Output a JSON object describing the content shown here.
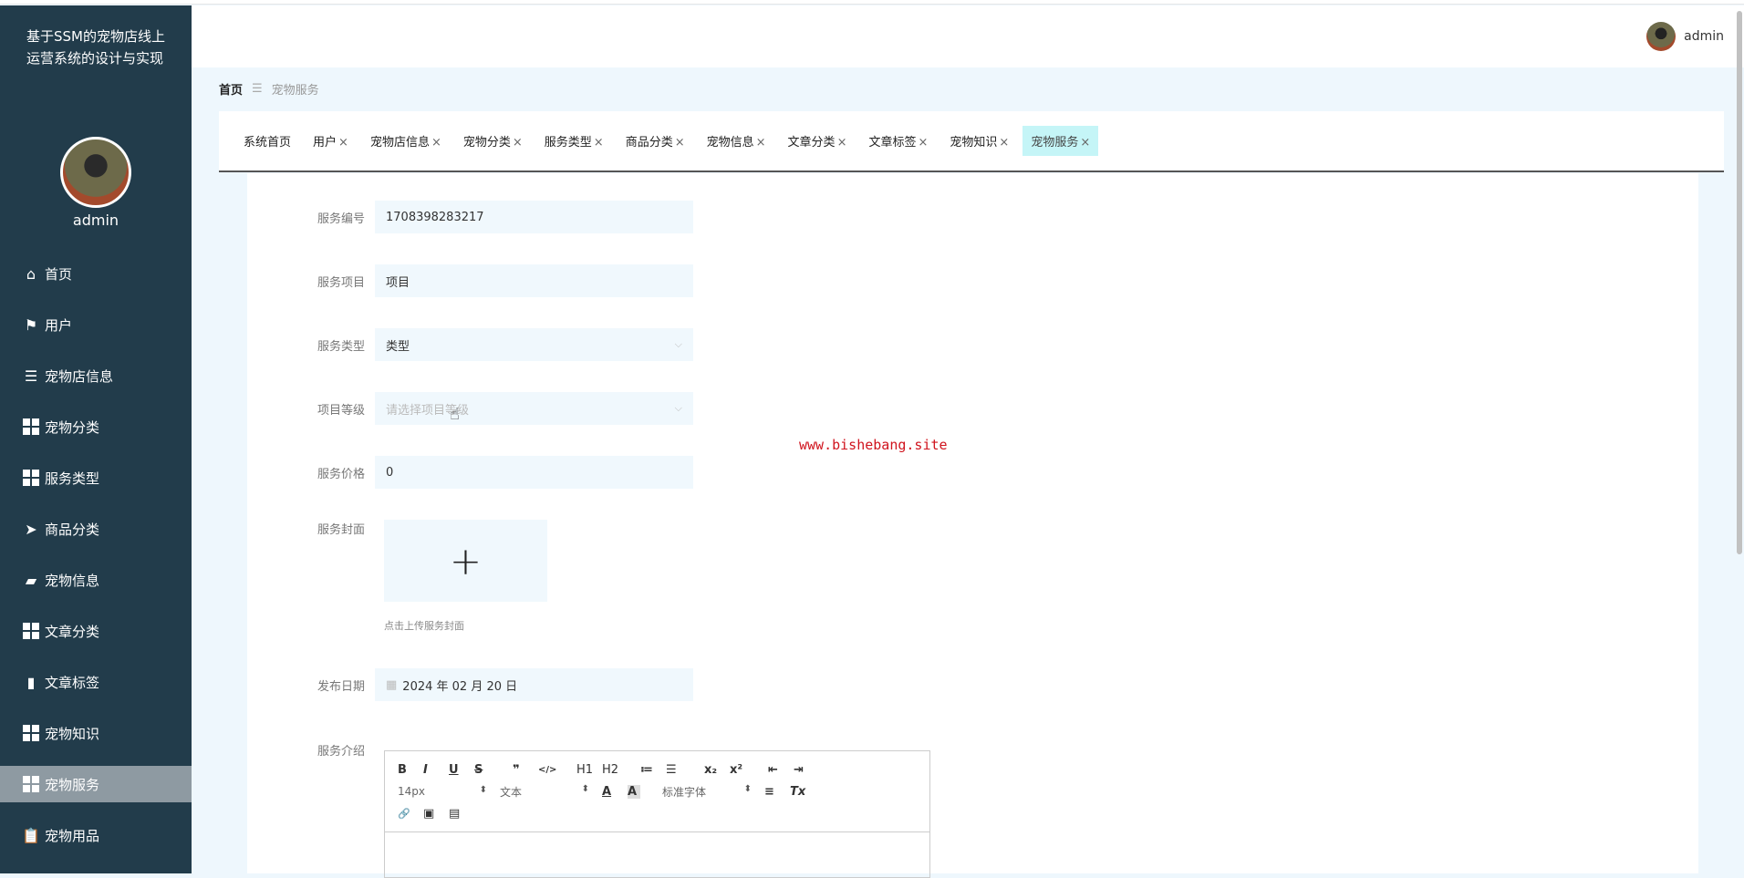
{
  "sidebar": {
    "title": "基于SSM的宠物店线上运营系统的设计与实现",
    "username": "admin",
    "items": [
      {
        "label": "首页",
        "icon": "home-icon"
      },
      {
        "label": "用户",
        "icon": "flag-icon"
      },
      {
        "label": "宠物店信息",
        "icon": "list-icon"
      },
      {
        "label": "宠物分类",
        "icon": "grid-icon"
      },
      {
        "label": "服务类型",
        "icon": "grid-icon"
      },
      {
        "label": "商品分类",
        "icon": "send-icon"
      },
      {
        "label": "宠物信息",
        "icon": "briefcase-icon"
      },
      {
        "label": "文章分类",
        "icon": "grid-icon"
      },
      {
        "label": "文章标签",
        "icon": "bar-chart-icon"
      },
      {
        "label": "宠物知识",
        "icon": "grid-icon"
      },
      {
        "label": "宠物服务",
        "icon": "grid-icon"
      },
      {
        "label": "宠物用品",
        "icon": "clipboard-icon"
      }
    ]
  },
  "header": {
    "username": "admin"
  },
  "breadcrumb": {
    "home": "首页",
    "separator": "☰",
    "current": "宠物服务"
  },
  "tabs": [
    "系统首页",
    "用户",
    "宠物店信息",
    "宠物分类",
    "服务类型",
    "商品分类",
    "宠物信息",
    "文章分类",
    "文章标签",
    "宠物知识",
    "宠物服务"
  ],
  "close_glyph": "×",
  "form": {
    "service_no": {
      "label": "服务编号",
      "value": "1708398283217"
    },
    "service_item": {
      "label": "服务项目",
      "value": "项目"
    },
    "service_type": {
      "label": "服务类型",
      "value": "类型"
    },
    "item_level": {
      "label": "项目等级",
      "placeholder": "请选择项目等级"
    },
    "price": {
      "label": "服务价格",
      "value": "0"
    },
    "cover": {
      "label": "服务封面",
      "plus": "+",
      "hint": "点击上传服务封面"
    },
    "date": {
      "label": "发布日期",
      "value": "2024 年 02 月 20 日"
    },
    "intro": {
      "label": "服务介绍"
    }
  },
  "editor": {
    "size": "14px",
    "header": "文本",
    "font": "标准字体",
    "buttons": {
      "bold": "B",
      "italic": "I",
      "underline": "U",
      "strike": "S",
      "quote": "❞",
      "code": "</>",
      "h1": "H1",
      "h2": "H2",
      "ol": "≔",
      "ul": "☰",
      "sub": "x₂",
      "sup": "x²",
      "outdent": "⇤",
      "indent": "⇥",
      "color": "A",
      "bg": "A",
      "align": "≡",
      "clean": "Tx",
      "link": "🔗",
      "image": "▣",
      "video": "▤"
    }
  },
  "watermark": "www.bishebang.site"
}
